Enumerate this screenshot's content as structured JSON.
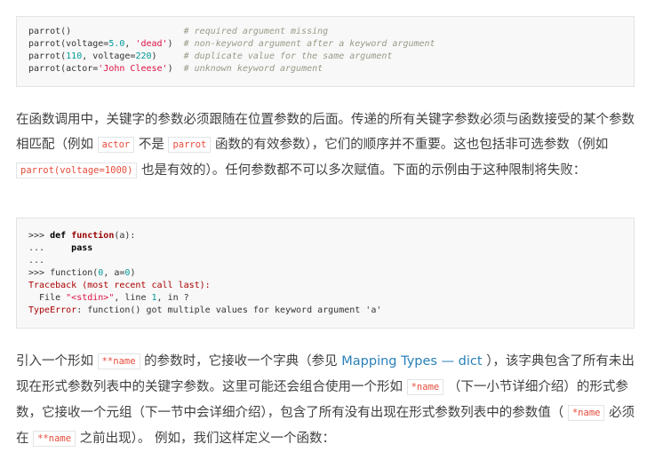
{
  "code1": {
    "lines": [
      {
        "parts": [
          [
            "fn",
            "parrot()"
          ],
          [
            "sp",
            "                     "
          ],
          [
            "com",
            "# required argument missing"
          ]
        ]
      },
      {
        "parts": [
          [
            "fn",
            "parrot(voltage="
          ],
          [
            "num",
            "5.0"
          ],
          [
            "fn",
            ", "
          ],
          [
            "str",
            "'dead'"
          ],
          [
            "fn",
            ")  "
          ],
          [
            "com",
            "# non-keyword argument after a keyword argument"
          ]
        ]
      },
      {
        "parts": [
          [
            "fn",
            "parrot("
          ],
          [
            "num",
            "110"
          ],
          [
            "fn",
            ", voltage="
          ],
          [
            "num",
            "220"
          ],
          [
            "fn",
            ")     "
          ],
          [
            "com",
            "# duplicate value for the same argument"
          ]
        ]
      },
      {
        "parts": [
          [
            "fn",
            "parrot(actor="
          ],
          [
            "str",
            "'John Cleese'"
          ],
          [
            "fn",
            ")  "
          ],
          [
            "com",
            "# unknown keyword argument"
          ]
        ]
      }
    ]
  },
  "para1": {
    "text_a": "在函数调用中，关键字的参数必须跟随在位置参数的后面。传递的所有关键字参数必须与函数接受的某个参数相匹配（例如",
    "code_a": "actor",
    "text_b": "不是",
    "code_b": "parrot",
    "text_c": "函数的有效参数），它们的顺序并不重要。这也包括非可选参数（例如",
    "code_c": "parrot(voltage=1000)",
    "text_d": "也是有效的）。任何参数都不可以多次赋值。下面的示例由于这种限制将失败："
  },
  "code2": {
    "lines": [
      {
        "parts": [
          [
            "prompt",
            ">>> "
          ],
          [
            "kw",
            "def"
          ],
          [
            "fn",
            " "
          ],
          [
            "fname",
            "function"
          ],
          [
            "fn",
            "(a):"
          ]
        ]
      },
      {
        "parts": [
          [
            "prompt",
            "...     "
          ],
          [
            "kw",
            "pass"
          ]
        ]
      },
      {
        "parts": [
          [
            "prompt",
            "..."
          ]
        ]
      },
      {
        "parts": [
          [
            "prompt",
            ">>> "
          ],
          [
            "fn",
            "function("
          ],
          [
            "num",
            "0"
          ],
          [
            "fn",
            ", a="
          ],
          [
            "num",
            "0"
          ],
          [
            "fn",
            ")"
          ]
        ]
      },
      {
        "parts": [
          [
            "err",
            "Traceback (most recent call last):"
          ]
        ]
      },
      {
        "parts": [
          [
            "fn",
            "  File "
          ],
          [
            "str",
            "\"<stdin>\""
          ],
          [
            "fn",
            ", line "
          ],
          [
            "num",
            "1"
          ],
          [
            "fn",
            ", in ?"
          ]
        ]
      },
      {
        "parts": [
          [
            "err",
            "TypeError"
          ],
          [
            "fn",
            ": function() got multiple values for keyword argument 'a'"
          ]
        ]
      }
    ]
  },
  "para2": {
    "text_a": "引入一个形如",
    "code_a": "**name",
    "text_b": "的参数时，它接收一个字典（参见",
    "link": "Mapping Types — dict",
    "text_c": "），该字典包含了所有未出现在形式参数列表中的关键字参数。这里可能还会组合使用一个形如",
    "code_b": "*name",
    "text_d": "（下一小节详细介绍）的形式参数，它接收一个元组（下一节中会详细介绍），包含了所有没有出现在形式参数列表中的参数值（",
    "code_c": "*name",
    "text_e": "必须在",
    "code_d": "**name",
    "text_f": "之前出现）。 例如，我们这样定义一个函数："
  },
  "colors": {
    "code_bg": "#f8f8f8",
    "inline_code": "#e74c3c",
    "link": "#2980b9",
    "comment": "#999988",
    "string": "#dd1144"
  }
}
